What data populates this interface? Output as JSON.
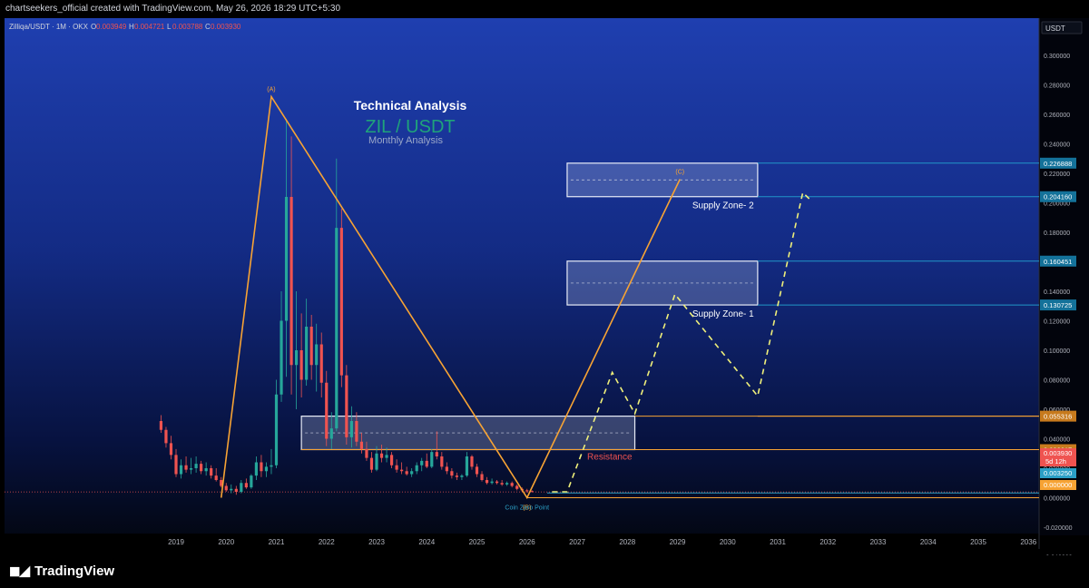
{
  "header": {
    "credit": "chartseekers_official created with TradingView.com, May 26, 2026 18:29 UTC+5:30",
    "symbol": "Zilliqa/USDT · 1M · OKX",
    "ohlc": [
      {
        "k": "O",
        "v": "0.003949"
      },
      {
        "k": "H",
        "v": "0.004721"
      },
      {
        "k": "L",
        "v": "0.003788"
      },
      {
        "k": "C",
        "v": "0.003930"
      }
    ],
    "currency": "USDT"
  },
  "titles": {
    "main": "Technical Analysis",
    "pair": "ZIL / USDT",
    "sub": "Monthly Analysis"
  },
  "colors": {
    "up": "#26a69a",
    "down": "#ef5350",
    "wave": "#f7a334",
    "projection": "#f0f07a",
    "level": "#2196c8",
    "accent_teal": "#1fa37a"
  },
  "chart_data": {
    "type": "candlestick",
    "title": "",
    "x_axis": {
      "type": "time",
      "ticks": [
        "2019",
        "2020",
        "2021",
        "2022",
        "2023",
        "2024",
        "2025",
        "2026",
        "2027",
        "2028",
        "2029",
        "2030",
        "2031",
        "2032",
        "2033",
        "2034",
        "2035",
        "2036"
      ]
    },
    "y_axis": {
      "range": [
        -0.05,
        0.31
      ],
      "ticks": [
        "0.300000",
        "0.280000",
        "0.260000",
        "0.240000",
        "0.220000",
        "0.200000",
        "0.180000",
        "0.160000",
        "0.140000",
        "0.120000",
        "0.100000",
        "0.080000",
        "0.060000",
        "0.040000",
        "0.020000",
        "0.000000",
        "-0.020000",
        "-0.040000"
      ]
    },
    "grid": false,
    "candles_monthly": [
      {
        "t": 2018.7,
        "o": 0.052,
        "h": 0.056,
        "l": 0.044,
        "c": 0.046
      },
      {
        "t": 2018.8,
        "o": 0.046,
        "h": 0.048,
        "l": 0.034,
        "c": 0.037
      },
      {
        "t": 2018.9,
        "o": 0.037,
        "h": 0.042,
        "l": 0.026,
        "c": 0.029
      },
      {
        "t": 2019.0,
        "o": 0.029,
        "h": 0.033,
        "l": 0.014,
        "c": 0.016
      },
      {
        "t": 2019.1,
        "o": 0.016,
        "h": 0.026,
        "l": 0.013,
        "c": 0.022
      },
      {
        "t": 2019.2,
        "o": 0.022,
        "h": 0.028,
        "l": 0.017,
        "c": 0.019
      },
      {
        "t": 2019.3,
        "o": 0.019,
        "h": 0.027,
        "l": 0.016,
        "c": 0.02
      },
      {
        "t": 2019.4,
        "o": 0.02,
        "h": 0.028,
        "l": 0.017,
        "c": 0.023
      },
      {
        "t": 2019.5,
        "o": 0.023,
        "h": 0.025,
        "l": 0.016,
        "c": 0.018
      },
      {
        "t": 2019.6,
        "o": 0.018,
        "h": 0.024,
        "l": 0.015,
        "c": 0.02
      },
      {
        "t": 2019.7,
        "o": 0.02,
        "h": 0.022,
        "l": 0.013,
        "c": 0.015
      },
      {
        "t": 2019.8,
        "o": 0.015,
        "h": 0.02,
        "l": 0.011,
        "c": 0.012
      },
      {
        "t": 2019.9,
        "o": 0.012,
        "h": 0.014,
        "l": 0.007,
        "c": 0.008
      },
      {
        "t": 2020.0,
        "o": 0.008,
        "h": 0.01,
        "l": 0.004,
        "c": 0.005
      },
      {
        "t": 2020.1,
        "o": 0.005,
        "h": 0.009,
        "l": 0.003,
        "c": 0.006
      },
      {
        "t": 2020.2,
        "o": 0.006,
        "h": 0.008,
        "l": 0.002,
        "c": 0.004
      },
      {
        "t": 2020.3,
        "o": 0.004,
        "h": 0.012,
        "l": 0.003,
        "c": 0.01
      },
      {
        "t": 2020.4,
        "o": 0.01,
        "h": 0.013,
        "l": 0.006,
        "c": 0.007
      },
      {
        "t": 2020.5,
        "o": 0.007,
        "h": 0.016,
        "l": 0.006,
        "c": 0.015
      },
      {
        "t": 2020.6,
        "o": 0.015,
        "h": 0.028,
        "l": 0.012,
        "c": 0.024
      },
      {
        "t": 2020.7,
        "o": 0.024,
        "h": 0.029,
        "l": 0.014,
        "c": 0.018
      },
      {
        "t": 2020.8,
        "o": 0.018,
        "h": 0.024,
        "l": 0.014,
        "c": 0.021
      },
      {
        "t": 2020.9,
        "o": 0.021,
        "h": 0.033,
        "l": 0.016,
        "c": 0.022
      },
      {
        "t": 2021.0,
        "o": 0.022,
        "h": 0.08,
        "l": 0.02,
        "c": 0.07
      },
      {
        "t": 2021.1,
        "o": 0.07,
        "h": 0.14,
        "l": 0.065,
        "c": 0.12
      },
      {
        "t": 2021.2,
        "o": 0.12,
        "h": 0.257,
        "l": 0.082,
        "c": 0.204
      },
      {
        "t": 2021.3,
        "o": 0.204,
        "h": 0.245,
        "l": 0.07,
        "c": 0.09
      },
      {
        "t": 2021.4,
        "o": 0.09,
        "h": 0.14,
        "l": 0.06,
        "c": 0.1
      },
      {
        "t": 2021.5,
        "o": 0.1,
        "h": 0.125,
        "l": 0.068,
        "c": 0.08
      },
      {
        "t": 2021.6,
        "o": 0.08,
        "h": 0.135,
        "l": 0.076,
        "c": 0.116
      },
      {
        "t": 2021.7,
        "o": 0.116,
        "h": 0.124,
        "l": 0.08,
        "c": 0.09
      },
      {
        "t": 2021.8,
        "o": 0.09,
        "h": 0.118,
        "l": 0.072,
        "c": 0.104
      },
      {
        "t": 2021.9,
        "o": 0.104,
        "h": 0.112,
        "l": 0.068,
        "c": 0.078
      },
      {
        "t": 2022.0,
        "o": 0.078,
        "h": 0.086,
        "l": 0.035,
        "c": 0.04
      },
      {
        "t": 2022.1,
        "o": 0.04,
        "h": 0.058,
        "l": 0.033,
        "c": 0.047
      },
      {
        "t": 2022.2,
        "o": 0.047,
        "h": 0.23,
        "l": 0.045,
        "c": 0.183
      },
      {
        "t": 2022.3,
        "o": 0.183,
        "h": 0.196,
        "l": 0.075,
        "c": 0.083
      },
      {
        "t": 2022.4,
        "o": 0.083,
        "h": 0.09,
        "l": 0.036,
        "c": 0.041
      },
      {
        "t": 2022.5,
        "o": 0.041,
        "h": 0.062,
        "l": 0.034,
        "c": 0.052
      },
      {
        "t": 2022.6,
        "o": 0.052,
        "h": 0.058,
        "l": 0.035,
        "c": 0.038
      },
      {
        "t": 2022.7,
        "o": 0.038,
        "h": 0.044,
        "l": 0.03,
        "c": 0.033
      },
      {
        "t": 2022.8,
        "o": 0.033,
        "h": 0.038,
        "l": 0.025,
        "c": 0.027
      },
      {
        "t": 2022.9,
        "o": 0.027,
        "h": 0.031,
        "l": 0.017,
        "c": 0.019
      },
      {
        "t": 2023.0,
        "o": 0.019,
        "h": 0.035,
        "l": 0.018,
        "c": 0.03
      },
      {
        "t": 2023.1,
        "o": 0.03,
        "h": 0.036,
        "l": 0.024,
        "c": 0.027
      },
      {
        "t": 2023.2,
        "o": 0.027,
        "h": 0.034,
        "l": 0.024,
        "c": 0.029
      },
      {
        "t": 2023.3,
        "o": 0.029,
        "h": 0.031,
        "l": 0.02,
        "c": 0.022
      },
      {
        "t": 2023.4,
        "o": 0.022,
        "h": 0.026,
        "l": 0.017,
        "c": 0.019
      },
      {
        "t": 2023.5,
        "o": 0.019,
        "h": 0.024,
        "l": 0.016,
        "c": 0.018
      },
      {
        "t": 2023.6,
        "o": 0.018,
        "h": 0.021,
        "l": 0.015,
        "c": 0.016
      },
      {
        "t": 2023.7,
        "o": 0.016,
        "h": 0.02,
        "l": 0.014,
        "c": 0.018
      },
      {
        "t": 2023.8,
        "o": 0.018,
        "h": 0.024,
        "l": 0.016,
        "c": 0.022
      },
      {
        "t": 2023.9,
        "o": 0.022,
        "h": 0.027,
        "l": 0.018,
        "c": 0.025
      },
      {
        "t": 2024.0,
        "o": 0.025,
        "h": 0.03,
        "l": 0.02,
        "c": 0.021
      },
      {
        "t": 2024.1,
        "o": 0.021,
        "h": 0.033,
        "l": 0.02,
        "c": 0.031
      },
      {
        "t": 2024.2,
        "o": 0.031,
        "h": 0.045,
        "l": 0.026,
        "c": 0.028
      },
      {
        "t": 2024.3,
        "o": 0.028,
        "h": 0.031,
        "l": 0.019,
        "c": 0.021
      },
      {
        "t": 2024.4,
        "o": 0.021,
        "h": 0.024,
        "l": 0.016,
        "c": 0.018
      },
      {
        "t": 2024.5,
        "o": 0.018,
        "h": 0.02,
        "l": 0.013,
        "c": 0.015
      },
      {
        "t": 2024.6,
        "o": 0.015,
        "h": 0.017,
        "l": 0.012,
        "c": 0.014
      },
      {
        "t": 2024.7,
        "o": 0.014,
        "h": 0.016,
        "l": 0.012,
        "c": 0.015
      },
      {
        "t": 2024.8,
        "o": 0.015,
        "h": 0.031,
        "l": 0.014,
        "c": 0.028
      },
      {
        "t": 2024.9,
        "o": 0.028,
        "h": 0.029,
        "l": 0.019,
        "c": 0.021
      },
      {
        "t": 2025.0,
        "o": 0.021,
        "h": 0.023,
        "l": 0.014,
        "c": 0.016
      },
      {
        "t": 2025.1,
        "o": 0.016,
        "h": 0.018,
        "l": 0.011,
        "c": 0.012
      },
      {
        "t": 2025.2,
        "o": 0.012,
        "h": 0.014,
        "l": 0.009,
        "c": 0.01
      },
      {
        "t": 2025.3,
        "o": 0.01,
        "h": 0.013,
        "l": 0.009,
        "c": 0.011
      },
      {
        "t": 2025.4,
        "o": 0.011,
        "h": 0.012,
        "l": 0.009,
        "c": 0.01
      },
      {
        "t": 2025.5,
        "o": 0.01,
        "h": 0.012,
        "l": 0.008,
        "c": 0.009
      },
      {
        "t": 2025.6,
        "o": 0.009,
        "h": 0.011,
        "l": 0.008,
        "c": 0.01
      },
      {
        "t": 2025.7,
        "o": 0.01,
        "h": 0.011,
        "l": 0.007,
        "c": 0.008
      },
      {
        "t": 2025.8,
        "o": 0.008,
        "h": 0.009,
        "l": 0.005,
        "c": 0.006
      },
      {
        "t": 2025.9,
        "o": 0.006,
        "h": 0.007,
        "l": 0.004,
        "c": 0.005
      },
      {
        "t": 2026.0,
        "o": 0.005,
        "h": 0.006,
        "l": 0.0035,
        "c": 0.0045
      },
      {
        "t": 2026.1,
        "o": 0.0045,
        "h": 0.005,
        "l": 0.0036,
        "c": 0.0039
      }
    ],
    "wave_path": [
      {
        "label": "",
        "t": 2019.9,
        "y": 0.0
      },
      {
        "label": "(A)",
        "t": 2020.9,
        "y": 0.272
      },
      {
        "label": "(B)",
        "t": 2026.0,
        "y": 0.0
      },
      {
        "label": "(C)",
        "t": 2029.05,
        "y": 0.216
      }
    ],
    "projection_path": [
      {
        "t": 2026.5,
        "y": 0.004
      },
      {
        "t": 2026.8,
        "y": 0.004
      },
      {
        "t": 2027.7,
        "y": 0.085
      },
      {
        "t": 2028.15,
        "y": 0.057
      },
      {
        "t": 2028.95,
        "y": 0.138
      },
      {
        "t": 2030.6,
        "y": 0.069
      },
      {
        "t": 2031.5,
        "y": 0.207
      },
      {
        "t": 2031.65,
        "y": 0.202
      }
    ],
    "zones": [
      {
        "name": "Supply Zone- 2",
        "t0": 2026.8,
        "t1": 2030.6,
        "y0": 0.20416,
        "y1": 0.226889
      },
      {
        "name": "Supply Zone- 1",
        "t0": 2026.8,
        "t1": 2030.6,
        "y0": 0.130725,
        "y1": 0.160451
      },
      {
        "name": "",
        "t0": 2021.5,
        "t1": 2028.15,
        "y0": 0.032617,
        "y1": 0.055316
      }
    ],
    "price_levels": [
      {
        "value": "0.226888",
        "y": 0.226888,
        "color": "#2196c8"
      },
      {
        "value": "0.204160",
        "y": 0.20416,
        "color": "#2196c8"
      },
      {
        "value": "0.160451",
        "y": 0.160451,
        "color": "#2196c8"
      },
      {
        "value": "0.130725",
        "y": 0.130725,
        "color": "#2196c8"
      },
      {
        "value": "0.055316",
        "y": 0.055316,
        "color": "#f7a334"
      },
      {
        "value": "0.032617",
        "y": 0.032617,
        "color": "#f7a334"
      }
    ],
    "tags": [
      {
        "value": "0.003930",
        "sub": "5d 12h",
        "y": 0.00393,
        "color": "#ef5350"
      },
      {
        "value": "0.003250",
        "sub": "",
        "y": 0.00325,
        "color": "#2b9fc6"
      },
      {
        "value": "0.000000",
        "sub": "",
        "y": 0.0,
        "color": "#f7a334"
      }
    ],
    "annotations": [
      {
        "text": "Resistance",
        "t": 2027.2,
        "y": 0.026,
        "color": "#ef5350"
      },
      {
        "text": "Coin Zero Point",
        "t": 2026.0,
        "y": -0.008,
        "color": "#2b9fc6"
      }
    ]
  },
  "footer": {
    "brand": "TradingView"
  }
}
